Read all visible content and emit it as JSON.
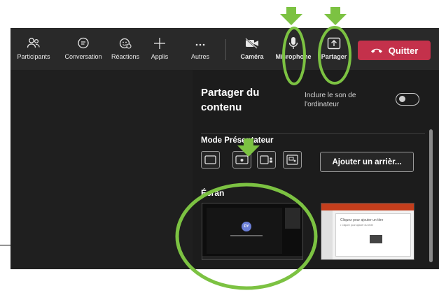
{
  "toolbar": {
    "items": [
      {
        "label": "Participants",
        "icon": "people-icon"
      },
      {
        "label": "Conversation",
        "icon": "chat-icon"
      },
      {
        "label": "Réactions",
        "icon": "reaction-icon"
      },
      {
        "label": "Applis",
        "icon": "plus-icon"
      },
      {
        "label": "Autres",
        "icon": "more-icon"
      },
      {
        "label": "Caméra",
        "icon": "camera-off-icon"
      },
      {
        "label": "Microphone",
        "icon": "microphone-icon"
      },
      {
        "label": "Partager",
        "icon": "share-icon"
      }
    ],
    "quit_label": "Quitter",
    "quit_color": "#c4314b"
  },
  "panel": {
    "title": "Partager du contenu",
    "sound_label": "Inclure le son de l'ordinateur",
    "sound_enabled": false,
    "presenter_mode_label": "Mode Présentateur",
    "add_background_label": "Ajouter un arrièr...",
    "screen_label": "Écran",
    "thumb_avatar_initials": "DY",
    "thumb_slide_title": "Cliquez pour ajouter un titre",
    "thumb_slide_text": "• Cliquez pour ajouter du texte"
  },
  "annotations": {
    "arrow_color": "#7cc242",
    "circle_color": "#7cc242"
  }
}
